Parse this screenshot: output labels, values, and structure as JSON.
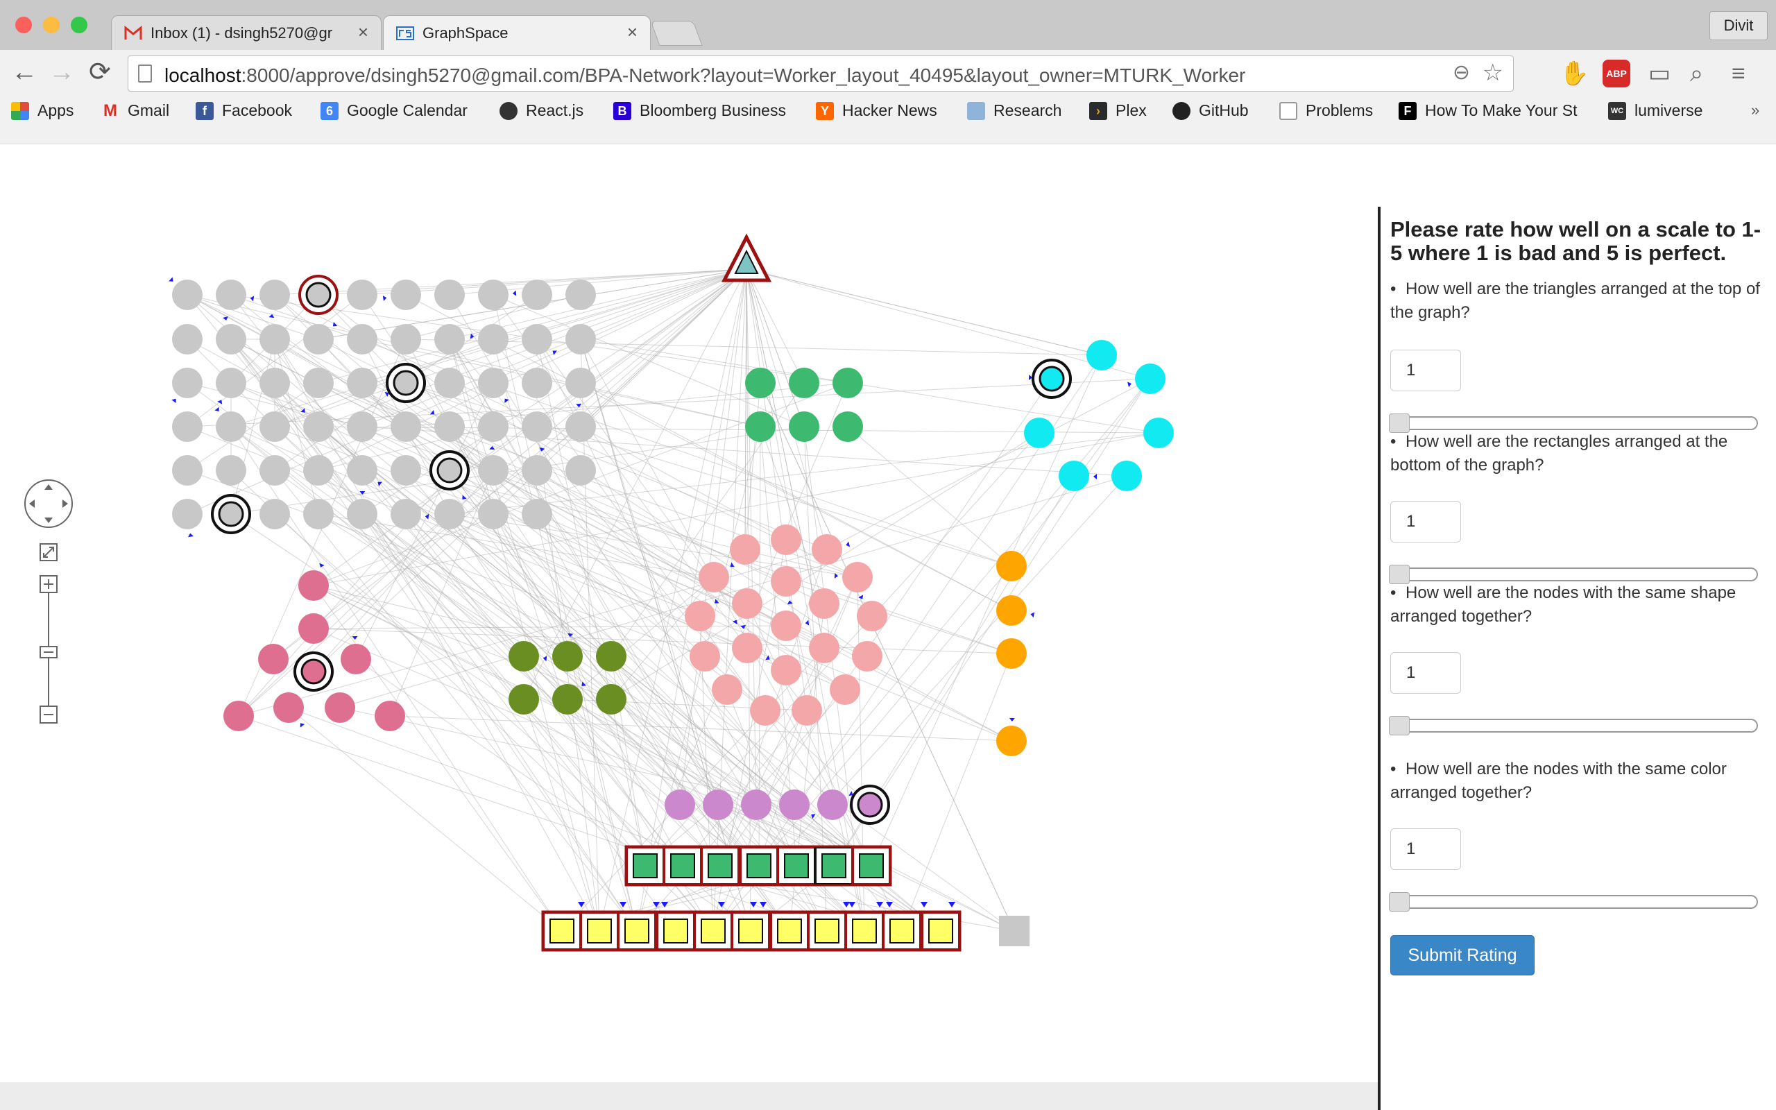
{
  "browser": {
    "tabs": [
      {
        "label": "Inbox (1) - dsingh5270@gr",
        "active": false,
        "icon": "gmail-icon"
      },
      {
        "label": "GraphSpace",
        "active": true,
        "icon": "graphspace-icon"
      }
    ],
    "user_button": "Divit",
    "url_host": "localhost",
    "url_path": ":8000/approve/dsingh5270@gmail.com/BPA-Network?layout=Worker_layout_40495&layout_owner=MTURK_Worker",
    "bookmarks": [
      {
        "label": "Apps",
        "icon": "apps-grid-icon",
        "color": "#e34b3a"
      },
      {
        "label": "Gmail",
        "icon": "gmail-icon",
        "color": "#d93025"
      },
      {
        "label": "Facebook",
        "icon": "facebook-icon",
        "color": "#3b5998"
      },
      {
        "label": "Google Calendar",
        "icon": "calendar-icon",
        "color": "#4285f4"
      },
      {
        "label": "React.js",
        "icon": "react-icon",
        "color": "#333"
      },
      {
        "label": "Bloomberg Business",
        "icon": "bloomberg-icon",
        "color": "#2800d7"
      },
      {
        "label": "Hacker News",
        "icon": "hacker-news-icon",
        "color": "#ff6600"
      },
      {
        "label": "Research",
        "icon": "folder-icon",
        "color": "#8fb3d9"
      },
      {
        "label": "Plex",
        "icon": "plex-icon",
        "color": "#282a2d"
      },
      {
        "label": "GitHub",
        "icon": "github-icon",
        "color": "#222"
      },
      {
        "label": "Problems",
        "icon": "page-icon",
        "color": "#999"
      },
      {
        "label": "How To Make Your St",
        "icon": "fastcompany-icon",
        "color": "#000"
      },
      {
        "label": "lumiverse",
        "icon": "lumiverse-icon",
        "color": "#333"
      }
    ]
  },
  "panel": {
    "title": "Please rate how well on a scale to 1-5 where 1 is bad and 5 is perfect.",
    "questions": [
      {
        "text": "How well are the triangles arranged at the top of the graph?",
        "value": "1",
        "slider_value": 1
      },
      {
        "text": "How well are the rectangles arranged at the bottom of the graph?",
        "value": "1",
        "slider_value": 1
      },
      {
        "text": "How well are the nodes with the same shape arranged together?",
        "value": "1",
        "slider_value": 1
      },
      {
        "text": "How well are the nodes with the same color arranged together?",
        "value": "1",
        "slider_value": 1
      }
    ],
    "submit_label": "Submit Rating"
  },
  "graph": {
    "colors": {
      "gray": "#c8c8c8",
      "green": "#3dba6f",
      "cyan": "#12eaf2",
      "pink": "#f4a7a9",
      "orange": "#ffa500",
      "olive": "#6b8e23",
      "magenta": "#df6f91",
      "violet": "#cc88cc",
      "dark_red": "#9b1010",
      "yellow": "#ffff66",
      "arrow": "#1a1aff"
    }
  }
}
